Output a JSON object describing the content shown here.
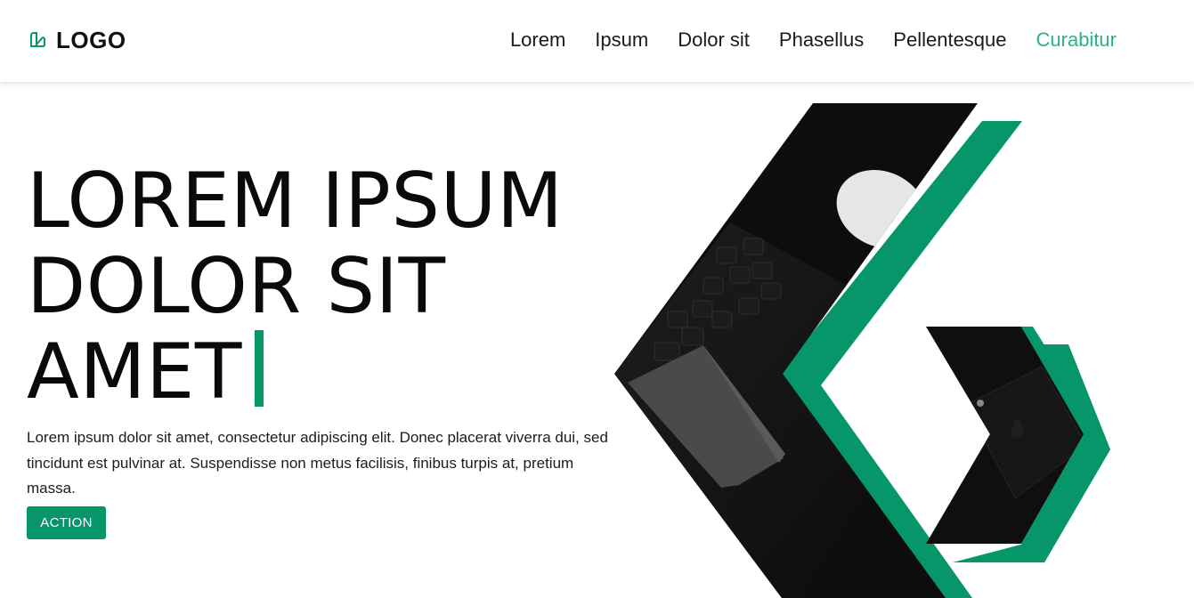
{
  "brand": {
    "logo_text": "LOGO",
    "logo_icon": "leaf-book-icon",
    "accent_color": "#069669",
    "active_link_color": "#2bb37b"
  },
  "nav": {
    "items": [
      {
        "label": "Lorem",
        "active": false
      },
      {
        "label": "Ipsum",
        "active": false
      },
      {
        "label": "Dolor sit",
        "active": false
      },
      {
        "label": "Phasellus",
        "active": false
      },
      {
        "label": "Pellentesque",
        "active": false
      },
      {
        "label": "Curabitur",
        "active": true
      }
    ]
  },
  "hero": {
    "title_lines": [
      "LOREM IPSUM",
      "DOLOR SIT",
      "AMET"
    ],
    "text": "Lorem ipsum dolor sit amet, consectetur adipiscing elit. Donec placerat viverra dui, sed tincidunt est pulvinar at. Suspendisse non metus facilisis, finibus turpis at, pretium massa.",
    "action_label": "ACTION",
    "image_1": "laptop-keyboard-photo",
    "image_2": "phone-photo"
  }
}
